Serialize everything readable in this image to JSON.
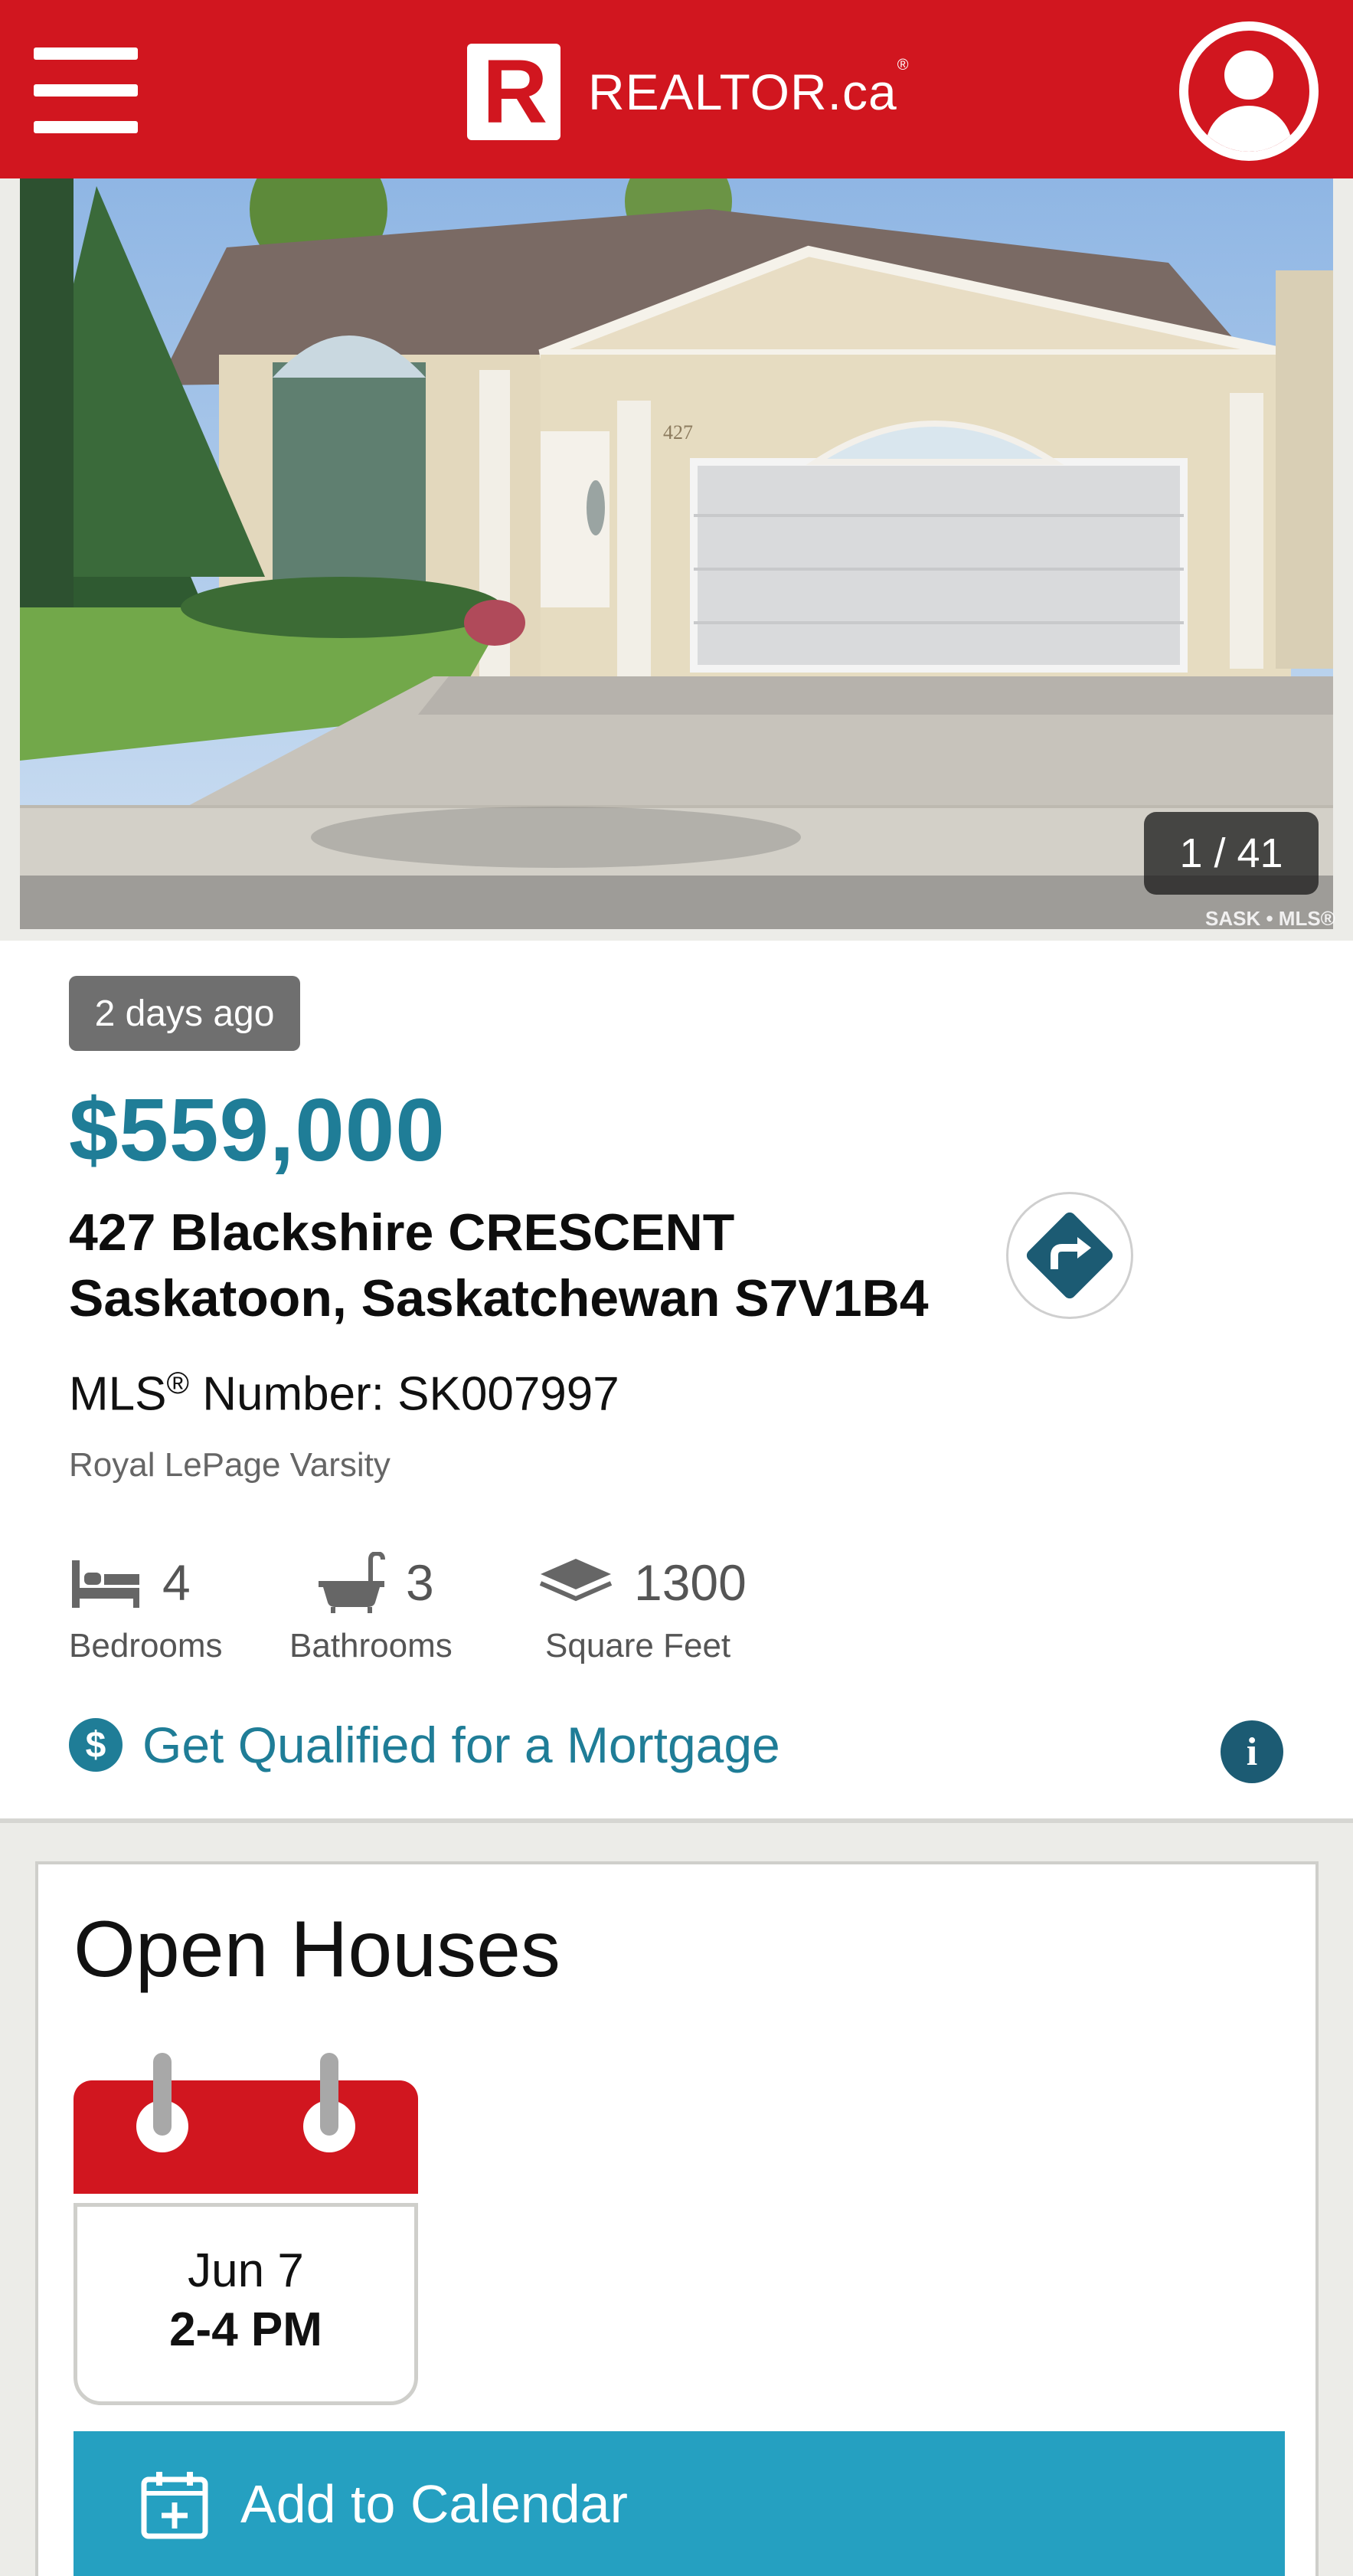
{
  "header": {
    "logo_text": "REALTOR.ca",
    "logo_mark": "R",
    "menu_icon": "hamburger-menu-icon",
    "account_icon": "user-account-icon"
  },
  "photo": {
    "counter": "1 / 41",
    "watermark": "SASK • MLS®",
    "house_number": "427"
  },
  "listing": {
    "age_badge": "2 days ago",
    "price": "$559,000",
    "address_line1": "427 Blackshire CRESCENT",
    "address_line2": "Saskatoon, Saskatchewan S7V1B4",
    "mls_label": "MLS",
    "mls_reg": "®",
    "mls_number": " Number: SK007997",
    "brokerage": "Royal LePage Varsity",
    "stats": {
      "bedrooms": {
        "value": "4",
        "label": "Bedrooms",
        "icon": "bed-icon"
      },
      "bathrooms": {
        "value": "3",
        "label": "Bathrooms",
        "icon": "bathtub-icon"
      },
      "square_feet": {
        "value": "1300",
        "label": "Square Feet",
        "icon": "area-layers-icon"
      }
    },
    "mortgage_link": "Get Qualified for a Mortgage",
    "mortgage_icon_glyph": "$",
    "info_glyph": "i"
  },
  "open_houses": {
    "title": "Open Houses",
    "date": "Jun 7",
    "time": "2-4 PM",
    "add_to_calendar": "Add to Calendar"
  },
  "colors": {
    "brand_red": "#d1161f",
    "accent_teal": "#1f7d97",
    "button_blue": "#25a0c1"
  }
}
